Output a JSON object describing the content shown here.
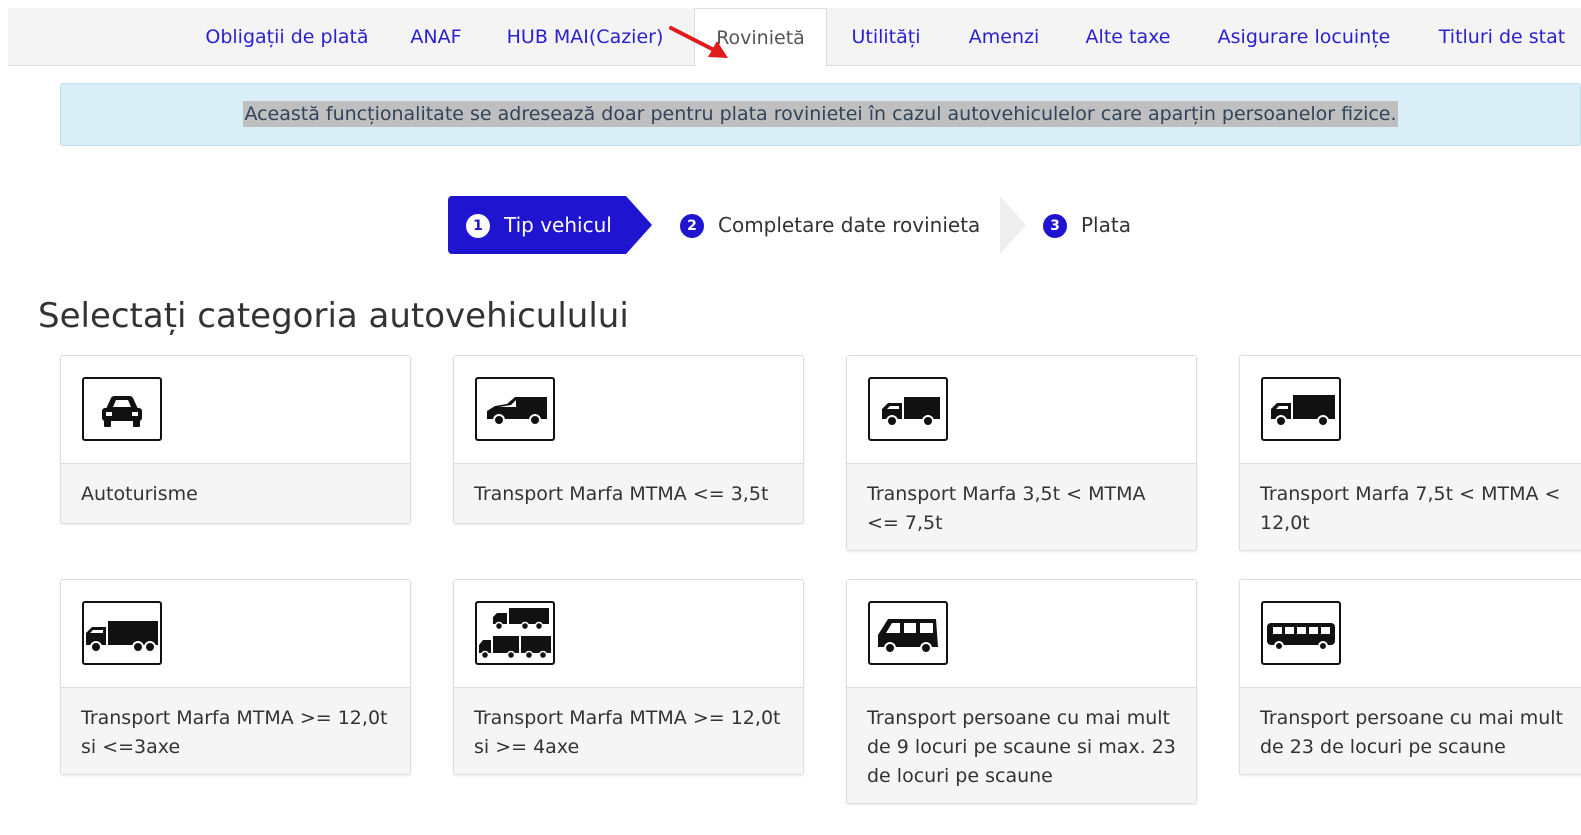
{
  "tabs": [
    {
      "label": "Obligații de plată"
    },
    {
      "label": "ANAF"
    },
    {
      "label": "HUB MAI(Cazier)"
    },
    {
      "label": "Rovinietă"
    },
    {
      "label": "Utilități"
    },
    {
      "label": "Amenzi"
    },
    {
      "label": "Alte taxe"
    },
    {
      "label": "Asigurare locuințe"
    },
    {
      "label": "Titluri de stat"
    }
  ],
  "active_tab": "Rovinietă",
  "banner": {
    "text": "Această funcționalitate se adresează doar pentru plata rovinietei în cazul autovehiculelor care aparțin persoanelor fizice."
  },
  "steps": [
    {
      "number": "1",
      "label": "Tip vehicul",
      "active": true
    },
    {
      "number": "2",
      "label": "Completare date rovinieta",
      "active": false
    },
    {
      "number": "3",
      "label": "Plata",
      "active": false
    }
  ],
  "title": "Selectați categoria autovehiculului",
  "categories": [
    {
      "label": "Autoturisme",
      "icon": "car-icon"
    },
    {
      "label": "Transport Marfa MTMA <= 3,5t",
      "icon": "van-icon"
    },
    {
      "label": "Transport Marfa 3,5t < MTMA <= 7,5t",
      "icon": "small-truck-icon"
    },
    {
      "label": "Transport Marfa 7,5t < MTMA < 12,0t",
      "icon": "medium-truck-icon"
    },
    {
      "label": "Transport Marfa MTMA >= 12,0t si <=3axe",
      "icon": "heavy-truck-icon"
    },
    {
      "label": "Transport Marfa MTMA >= 12,0t si >= 4axe",
      "icon": "truck-trailer-icon"
    },
    {
      "label": "Transport persoane cu mai mult de 9 locuri pe scaune si max. 23 de locuri pe scaune",
      "icon": "minibus-icon"
    },
    {
      "label": "Transport persoane cu mai mult de 23 de locuri pe scaune",
      "icon": "bus-icon"
    }
  ],
  "colors": {
    "link": "#2a1fd0",
    "step_active_bg": "#1f14cf",
    "banner_bg": "#d9eef6",
    "banner_highlight": "#bfbfbf"
  }
}
